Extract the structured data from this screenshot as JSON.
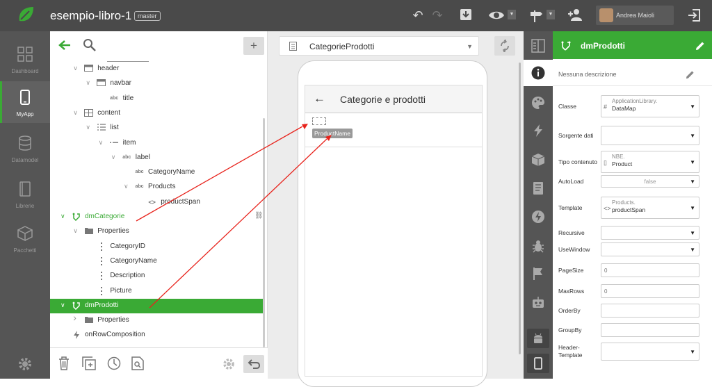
{
  "colors": {
    "accent": "#3aaa35",
    "dark": "#4a4a4a",
    "nav": "#555555",
    "arrow": "#e8231c"
  },
  "app": {
    "project": "esempio-libro-1",
    "branch": "master",
    "user": "Andrea Maioli"
  },
  "leftnav": [
    {
      "label": "Dashboard",
      "icon": "dashboard-icon"
    },
    {
      "label": "MyApp",
      "icon": "phone-icon"
    },
    {
      "label": "Datamodel",
      "icon": "database-icon"
    },
    {
      "label": "Librerie",
      "icon": "book-icon"
    },
    {
      "label": "Pacchetti",
      "icon": "box-icon"
    }
  ],
  "tree": {
    "items": [
      {
        "label": "header",
        "icon": "layout-icon",
        "iconText": "",
        "level": 2,
        "chev": "v"
      },
      {
        "label": "navbar",
        "icon": "layout-icon",
        "iconText": "",
        "level": 3,
        "chev": "v"
      },
      {
        "label": "title",
        "icon": "text-icon",
        "iconText": "abc",
        "level": 4,
        "chev": ""
      },
      {
        "label": "content",
        "icon": "grid-icon",
        "iconText": "",
        "level": 2,
        "chev": "v"
      },
      {
        "label": "list",
        "icon": "list-icon",
        "iconText": "",
        "level": 3,
        "chev": "v"
      },
      {
        "label": "item",
        "icon": "item-icon",
        "iconText": "",
        "level": 4,
        "chev": "v"
      },
      {
        "label": "label",
        "icon": "text-icon",
        "iconText": "abc",
        "level": 5,
        "chev": "v"
      },
      {
        "label": "CategoryName",
        "icon": "text-icon",
        "iconText": "abc",
        "level": 6,
        "chev": ""
      },
      {
        "label": "Products",
        "icon": "text-icon",
        "iconText": "abc",
        "level": 6,
        "chev": "v"
      },
      {
        "label": "productSpan",
        "icon": "code-icon",
        "iconText": "<>",
        "level": 7,
        "chev": ""
      },
      {
        "label": "dmCategorie",
        "icon": "datamap-icon",
        "iconText": "",
        "level": 1,
        "chev": "v",
        "green": true
      },
      {
        "label": "Properties",
        "icon": "folder-icon",
        "iconText": "",
        "level": 2,
        "chev": "v"
      },
      {
        "label": "CategoryID",
        "icon": "field-icon",
        "iconText": "",
        "level": 3,
        "chev": ""
      },
      {
        "label": "CategoryName",
        "icon": "field-icon",
        "iconText": "",
        "level": 3,
        "chev": ""
      },
      {
        "label": "Description",
        "icon": "field-icon",
        "iconText": "",
        "level": 3,
        "chev": ""
      },
      {
        "label": "Picture",
        "icon": "field-icon",
        "iconText": "",
        "level": 3,
        "chev": ""
      },
      {
        "label": "dmProdotti",
        "icon": "datamap-icon",
        "iconText": "",
        "level": 1,
        "chev": "v",
        "selected": true
      },
      {
        "label": "Properties",
        "icon": "folder-icon",
        "iconText": "",
        "level": 2,
        "chev": ">"
      },
      {
        "label": "onRowComposition",
        "icon": "lightning-icon",
        "iconText": "",
        "level": 1,
        "chev": ""
      }
    ]
  },
  "center": {
    "selector": "CategorieProdotti",
    "screen_title": "Categorie e prodotti",
    "product_name": "ProductName"
  },
  "panel": {
    "title": "dmProdotti",
    "description": "Nessuna descrizione",
    "props": [
      {
        "label": "Classe",
        "v1": "ApplicationLibrary.",
        "v2": "DataMap",
        "icon": "#",
        "dd": true
      },
      {
        "label": "Sorgente dati",
        "dd": true
      },
      {
        "label": "Tipo contenuto",
        "v1": "NBE.",
        "v2": "Product",
        "icon": "📄",
        "dd": true
      },
      {
        "label": "AutoLoad",
        "center": "false",
        "dd": true
      },
      {
        "label": "Template",
        "v1": "Products.",
        "v2": "productSpan",
        "icon": "<>",
        "dd": true
      },
      {
        "label": "Recursive",
        "dd": true
      },
      {
        "label": "UseWindow",
        "dd": true
      },
      {
        "label": "PageSize",
        "left": "0"
      },
      {
        "label": "MaxRows",
        "left": "0"
      },
      {
        "label": "OrderBy"
      },
      {
        "label": "GroupBy"
      },
      {
        "label": "Header-\nTemplate",
        "dd": true
      }
    ]
  }
}
